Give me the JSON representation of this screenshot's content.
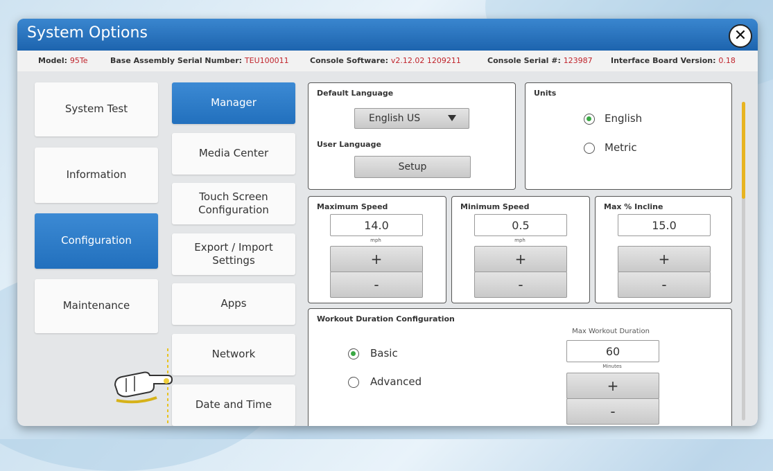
{
  "window": {
    "title": "System Options"
  },
  "info": {
    "model_label": "Model:",
    "model_value": "95Te",
    "base_label": "Base Assembly Serial Number:",
    "base_value": "TEU100011",
    "console_sw_label": "Console Software:",
    "console_sw_value": "v2.12.02 1209211",
    "console_serial_label": "Console Serial #:",
    "console_serial_value": "123987",
    "interface_label": "Interface Board Version:",
    "interface_value": "0.18"
  },
  "left_nav": [
    {
      "label": "System Test",
      "active": false
    },
    {
      "label": "Information",
      "active": false
    },
    {
      "label": "Configuration",
      "active": true
    },
    {
      "label": "Maintenance",
      "active": false
    }
  ],
  "sub_nav": [
    {
      "label": "Manager",
      "active": true
    },
    {
      "label": "Media Center",
      "active": false
    },
    {
      "label": "Touch Screen Configuration",
      "active": false
    },
    {
      "label": "Export / Import Settings",
      "active": false
    },
    {
      "label": "Apps",
      "active": false
    },
    {
      "label": "Network",
      "active": false
    },
    {
      "label": "Date and Time",
      "active": false
    }
  ],
  "language": {
    "default_label": "Default Language",
    "default_value": "English US",
    "user_label": "User Language",
    "setup_button": "Setup"
  },
  "units": {
    "label": "Units",
    "options": [
      {
        "label": "English",
        "selected": true
      },
      {
        "label": "Metric",
        "selected": false
      }
    ]
  },
  "max_speed": {
    "label": "Maximum Speed",
    "value": "14.0",
    "unit": "mph",
    "plus": "+",
    "minus": "-"
  },
  "min_speed": {
    "label": "Minimum Speed",
    "value": "0.5",
    "unit": "mph",
    "plus": "+",
    "minus": "-"
  },
  "max_incline": {
    "label": "Max % Incline",
    "value": "15.0",
    "plus": "+",
    "minus": "-"
  },
  "workout": {
    "label": "Workout Duration Configuration",
    "options": [
      {
        "label": "Basic",
        "selected": true
      },
      {
        "label": "Advanced",
        "selected": false
      }
    ],
    "max_label": "Max Workout Duration",
    "max_value": "60",
    "max_unit": "Minutes",
    "plus": "+",
    "minus": "-"
  },
  "colors": {
    "accent": "#2270bd",
    "selected_radio": "#3aa844",
    "value_red": "#c0232b",
    "scroll_thumb": "#e8b421"
  },
  "icons": {
    "close": "close-icon",
    "dropdown": "triangle-down-icon",
    "pointer": "hand-pointer-icon"
  }
}
